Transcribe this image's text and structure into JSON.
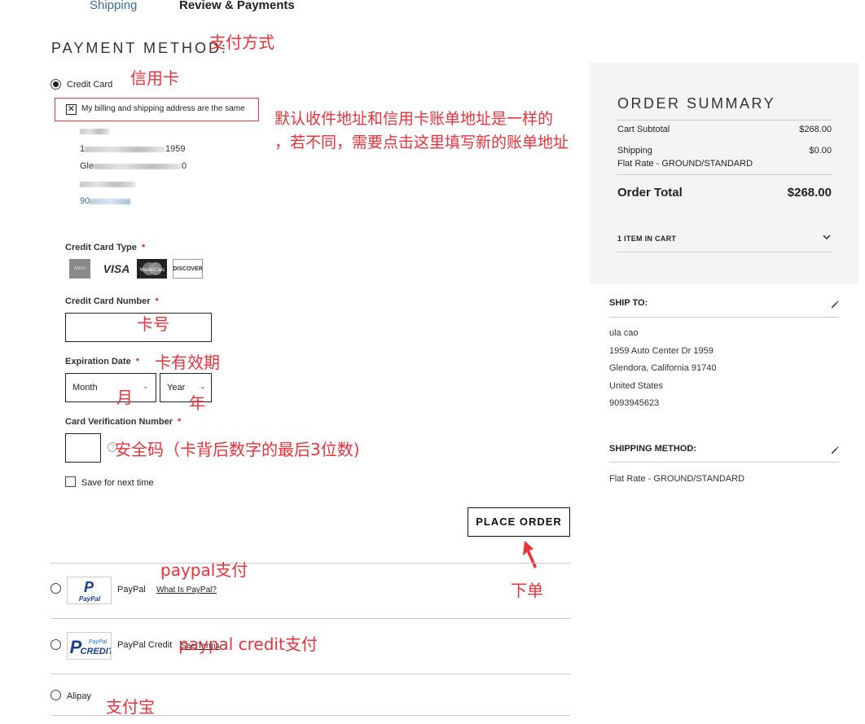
{
  "steps": {
    "shipping": "Shipping",
    "review": "Review & Payments"
  },
  "payment": {
    "title": "PAYMENT METHOD:",
    "credit_card": {
      "label": "Credit Card",
      "selected": true,
      "billing_same_label": "My billing and shipping address are the same",
      "billing_same_checked": true,
      "billing_address_visible": [
        "1",
        "1959",
        "Gle",
        "0",
        "90"
      ],
      "card_type_label": "Credit Card Type",
      "card_types": [
        "American Express",
        "VISA",
        "MasterCard",
        "DISCOVER"
      ],
      "card_number_label": "Credit Card Number",
      "card_number_value": "",
      "expiration_label": "Expiration Date",
      "month_value": "Month",
      "year_value": "Year",
      "cvv_label": "Card Verification Number",
      "cvv_value": "",
      "save_label": "Save for next time",
      "save_checked": false,
      "required_mark": "*"
    },
    "place_order": "PLACE ORDER",
    "paypal": {
      "label": "PayPal",
      "link": "What Is PayPal?",
      "logo_text": "PayPal"
    },
    "paypal_credit": {
      "label": "PayPal Credit",
      "link": "See Terms",
      "logo_text_top": "PayPal",
      "logo_text_bottom": "CREDIT"
    },
    "alipay": {
      "label": "Alipay"
    }
  },
  "summary": {
    "title": "ORDER SUMMARY",
    "subtotal_label": "Cart Subtotal",
    "subtotal_value": "$268.00",
    "shipping_label": "Shipping",
    "shipping_method": "Flat Rate - GROUND/STANDARD",
    "shipping_value": "$0.00",
    "total_label": "Order Total",
    "total_value": "$268.00",
    "items_label": "1 ITEM IN CART"
  },
  "ship_to": {
    "title": "SHIP TO:",
    "lines": [
      "ula cao",
      "1959 Auto Center Dr 1959",
      "Glendora, California 91740",
      "United States",
      "9093945623"
    ]
  },
  "shipping_method": {
    "title": "SHIPPING METHOD:",
    "value": "Flat Rate - GROUND/STANDARD"
  },
  "annotations": {
    "payment_method": "支付方式",
    "credit_card": "信用卡",
    "billing_note_1": "默认收件地址和信用卡账单地址是一样的",
    "billing_note_2": "，若不同，需要点击这里填写新的账单地址",
    "card_number": "卡号",
    "expiration": "卡有效期",
    "month": "月",
    "year": "年",
    "cvv": "安全码（卡背后数字的最后3位数)",
    "place_order": "下单",
    "paypal": "paypal支付",
    "paypal_credit": "paypal credit支付",
    "alipay": "支付宝"
  }
}
